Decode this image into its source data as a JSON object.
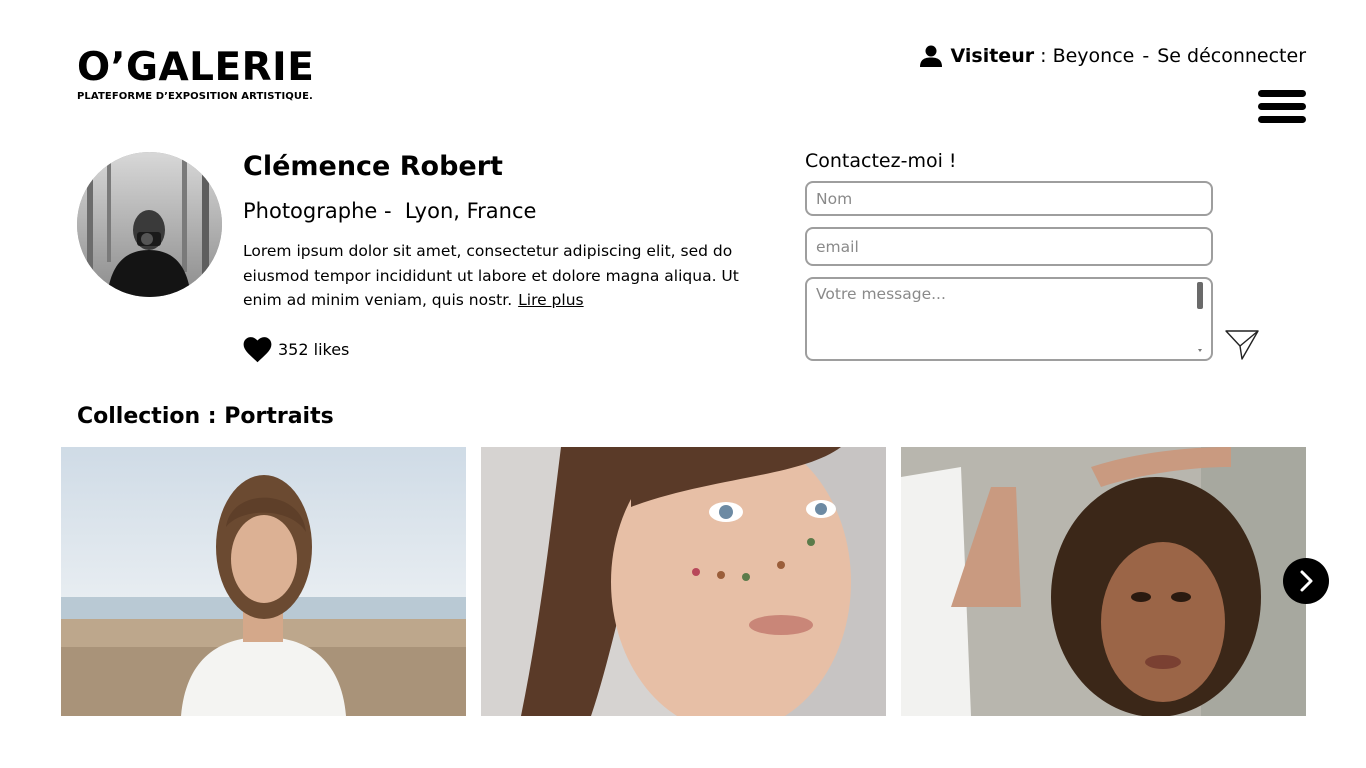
{
  "brand": {
    "name": "O’GALERIE",
    "tagline": "PLATEFORME D’EXPOSITION ARTISTIQUE."
  },
  "user": {
    "icon": "user-icon",
    "role": "Visiteur",
    "separator_colon": " : ",
    "name": "Beyonce",
    "separator": "-",
    "logout": "Se déconnecter"
  },
  "menu": {
    "icon": "hamburger-menu-icon"
  },
  "artist": {
    "name": "Clémence Robert",
    "profession_location": "Photographe -  Lyon, France",
    "bio": "Lorem ipsum dolor sit amet, consectetur adipiscing elit, sed do eiusmod tempor incididunt ut labore et dolore magna aliqua. Ut enim ad minim veniam, quis nostr.",
    "read_more": "Lire plus",
    "likes": "352 likes",
    "likes_icon": "heart-icon"
  },
  "contact": {
    "title": "Contactez-moi !",
    "name_placeholder": "Nom",
    "email_placeholder": "email",
    "message_placeholder": "Votre message...",
    "send_icon": "send-icon"
  },
  "collection": {
    "title": "Collection : Portraits",
    "next_icon": "chevron-right-icon"
  },
  "colors": {
    "text": "#000000",
    "background": "#ffffff",
    "input_border": "#9e9e9e"
  }
}
